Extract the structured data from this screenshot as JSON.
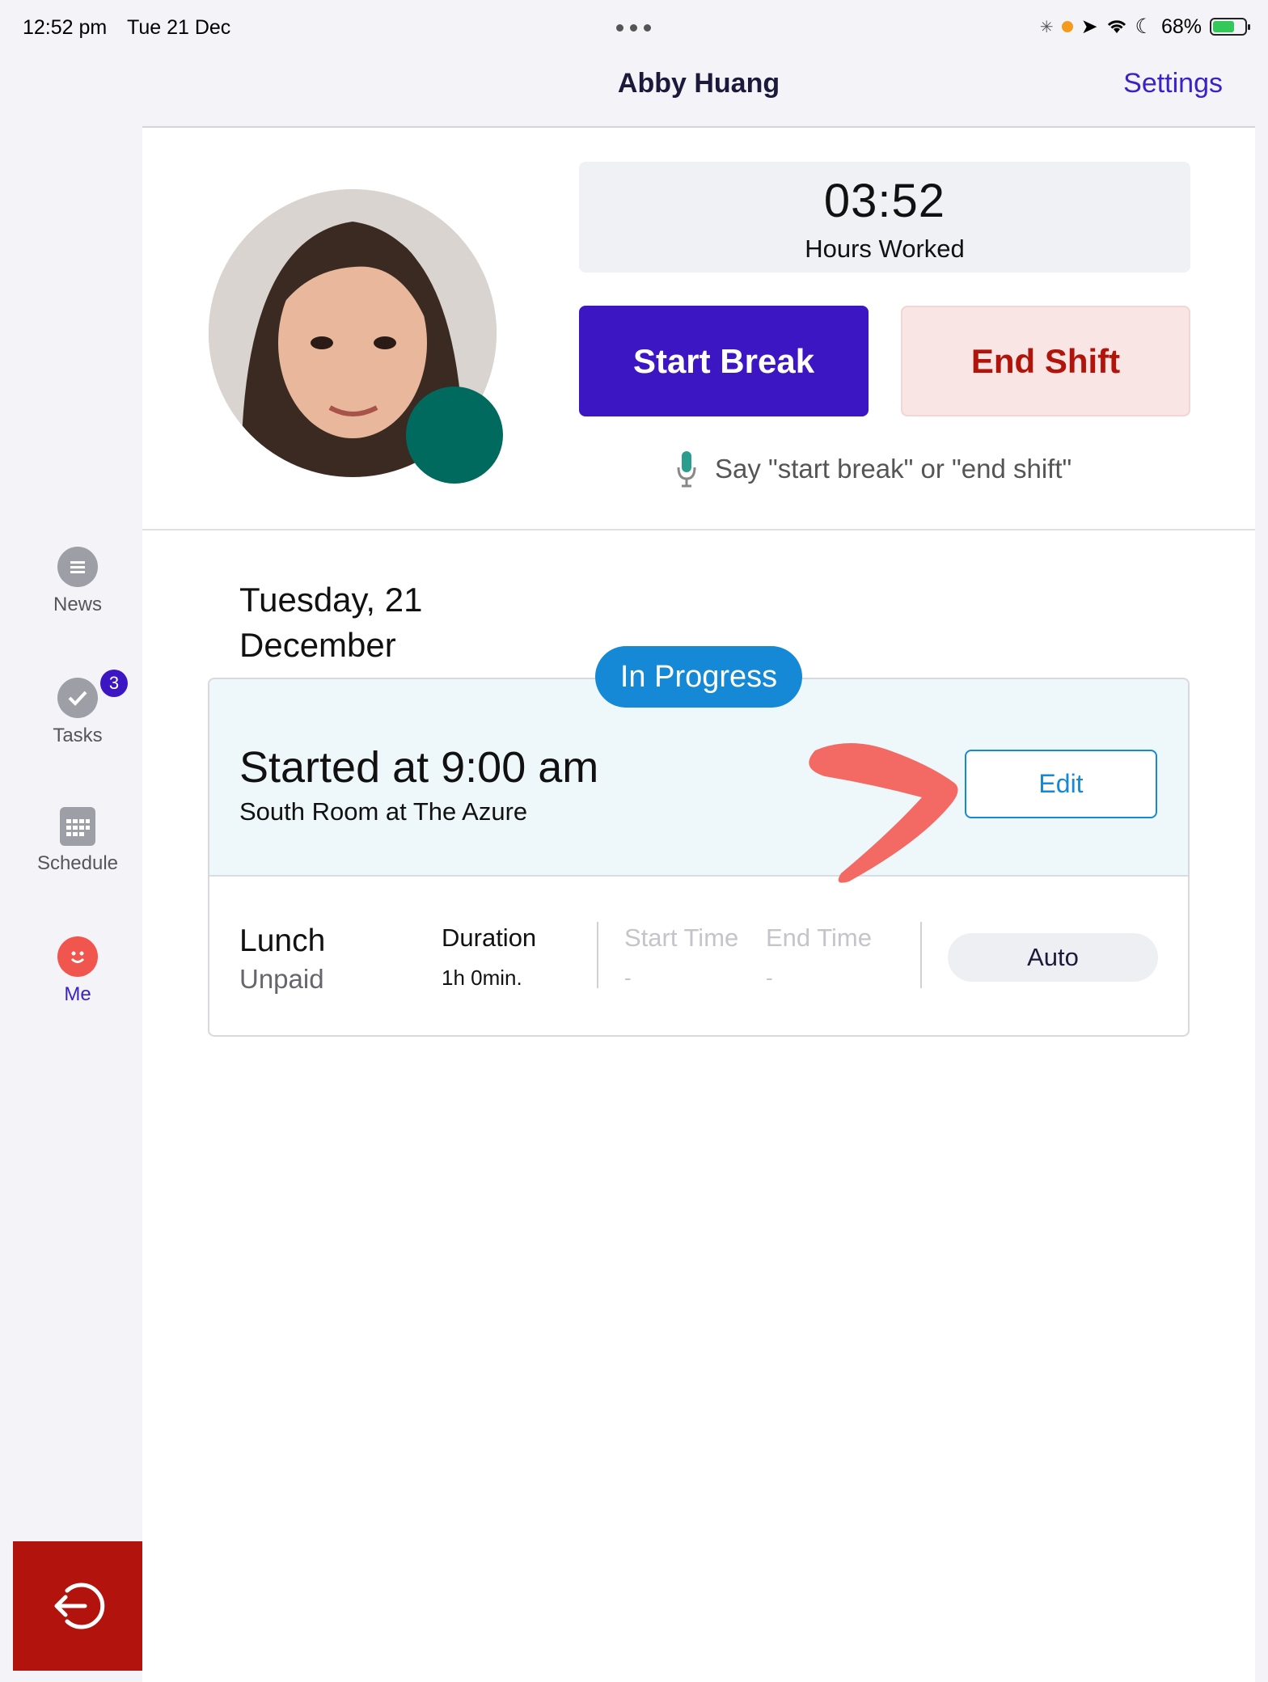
{
  "status_bar": {
    "time": "12:52 pm",
    "date": "Tue 21 Dec",
    "battery": "68%"
  },
  "header": {
    "title": "Abby Huang",
    "settings_label": "Settings"
  },
  "profile": {
    "hours_value": "03:52",
    "hours_label": "Hours Worked",
    "start_break_label": "Start Break",
    "end_shift_label": "End Shift",
    "voice_hint": "Say \"start break\" or \"end shift\"",
    "status_color": "#006a5e"
  },
  "sidebar": {
    "items": [
      {
        "label": "News",
        "icon": "chat-bubble-icon"
      },
      {
        "label": "Tasks",
        "icon": "check-circle-icon",
        "badge": "3"
      },
      {
        "label": "Schedule",
        "icon": "calendar-icon"
      },
      {
        "label": "Me",
        "icon": "smiley-icon",
        "active": true
      }
    ],
    "logout_icon": "logout-icon"
  },
  "shift": {
    "date_heading": "Tuesday, 21 December",
    "status": "In Progress",
    "started": "Started at 9:00 am",
    "location": "South Room at The Azure",
    "edit_label": "Edit"
  },
  "break": {
    "name": "Lunch",
    "type": "Unpaid",
    "duration_label": "Duration",
    "duration_value": "1h 0min.",
    "start_label": "Start Time",
    "start_value": "-",
    "end_label": "End Time",
    "end_value": "-",
    "auto_label": "Auto"
  },
  "colors": {
    "primary": "#3d16c4",
    "danger": "#b2130c",
    "info": "#1589d6",
    "annotation": "#f26a63"
  }
}
